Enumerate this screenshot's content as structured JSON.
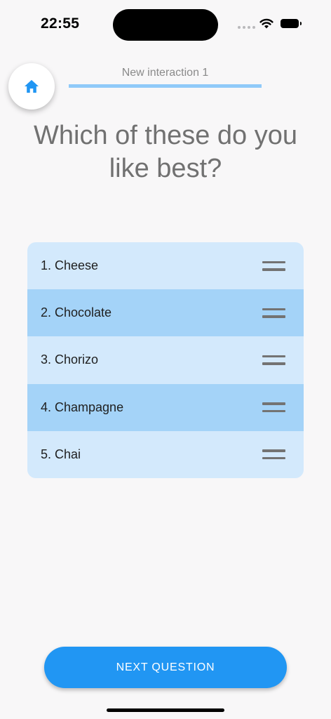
{
  "status_bar": {
    "time": "22:55"
  },
  "header": {
    "home_icon": "home-icon",
    "progress_label": "New interaction 1",
    "progress_fraction": 1.0,
    "progress_color": "#90caf9"
  },
  "question": {
    "text": "Which of these do you like best?"
  },
  "options": [
    {
      "label": "1. Cheese",
      "icon": "drag-handle-icon"
    },
    {
      "label": "2. Chocolate",
      "icon": "drag-handle-icon"
    },
    {
      "label": "3. Chorizo",
      "icon": "drag-handle-icon"
    },
    {
      "label": "4. Champagne",
      "icon": "drag-handle-icon"
    },
    {
      "label": "5. Chai",
      "icon": "drag-handle-icon"
    }
  ],
  "footer": {
    "next_label": "NEXT QUESTION"
  },
  "colors": {
    "accent": "#2196f3",
    "row_light": "#d3e9fc",
    "row_dark": "#a4d3f8"
  }
}
